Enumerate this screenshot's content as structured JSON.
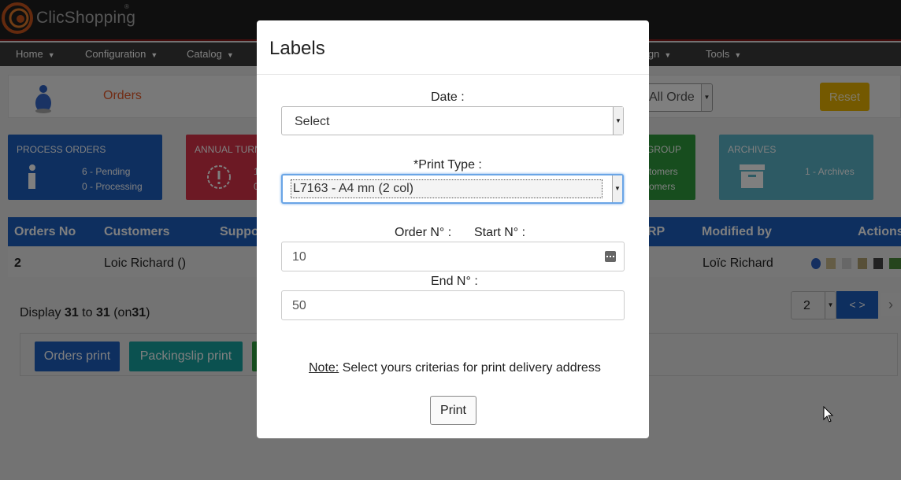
{
  "brand": {
    "name": "ClicShopping",
    "registered": "®"
  },
  "nav": {
    "home": "Home",
    "configuration": "Configuration",
    "catalog": "Catalog",
    "design_partial": "ign",
    "tools": "Tools"
  },
  "page": {
    "title": "Orders",
    "orders_filter_value": "All Orde",
    "reset_label": "Reset"
  },
  "tiles": {
    "process": {
      "title": "PROCESS ORDERS",
      "pending": "6 - Pending",
      "processing": "0 - Processing"
    },
    "annual": {
      "title": "ANNUAL TURN",
      "line1": "1",
      "line2": "0"
    },
    "group": {
      "title": "GROUP",
      "line1": "tomers",
      "line2": "omers"
    },
    "archives": {
      "title": "ARCHIVES",
      "line1": "1 - Archives"
    }
  },
  "table": {
    "headers": {
      "orders_no": "Orders No",
      "customers": "Customers",
      "support": "Suppo",
      "erp": "RP",
      "modified_by": "Modified by",
      "actions": "Actions"
    },
    "row": {
      "orders_no": "2",
      "customer": "Loic Richard ()",
      "modified_by": "Loïc Richard"
    }
  },
  "pagination": {
    "display_prefix": "Display",
    "from": "31",
    "to_word": "to",
    "to": "31",
    "on_prefix": "(on",
    "total": "31",
    "on_suffix": ")",
    "page_value": "2",
    "nav_label": "< >",
    "next": "›"
  },
  "buttons": {
    "orders_print": "Orders print",
    "packingslip_print": "Packingslip print"
  },
  "modal": {
    "title": "Labels",
    "date_label": "Date :",
    "date_value": "Select",
    "print_type_label": "*Print Type :",
    "print_type_value": "L7163 - A4 mn (2 col)",
    "order_no_label": "Order N° :",
    "start_no_label": "Start N° :",
    "start_value": "10",
    "end_no_label": "End N° :",
    "end_value": "50",
    "note_label": "Note:",
    "note_text": " Select yours criterias for print delivery address",
    "print_label": "Print"
  },
  "colors": {
    "primary_blue": "#1d5fbf",
    "danger_red": "#d93348",
    "success_green": "#2e9a3c",
    "info_cyan": "#5ab4c8",
    "warning_yellow": "#e8b200",
    "orders_title": "#e45a2a",
    "packingslip_teal": "#17a2a0"
  },
  "icons": [
    "logo-swirl-icon",
    "user-orders-icon",
    "info-icon",
    "alert-circle-icon",
    "archive-box-icon",
    "calendar-icon",
    "cursor-icon"
  ]
}
